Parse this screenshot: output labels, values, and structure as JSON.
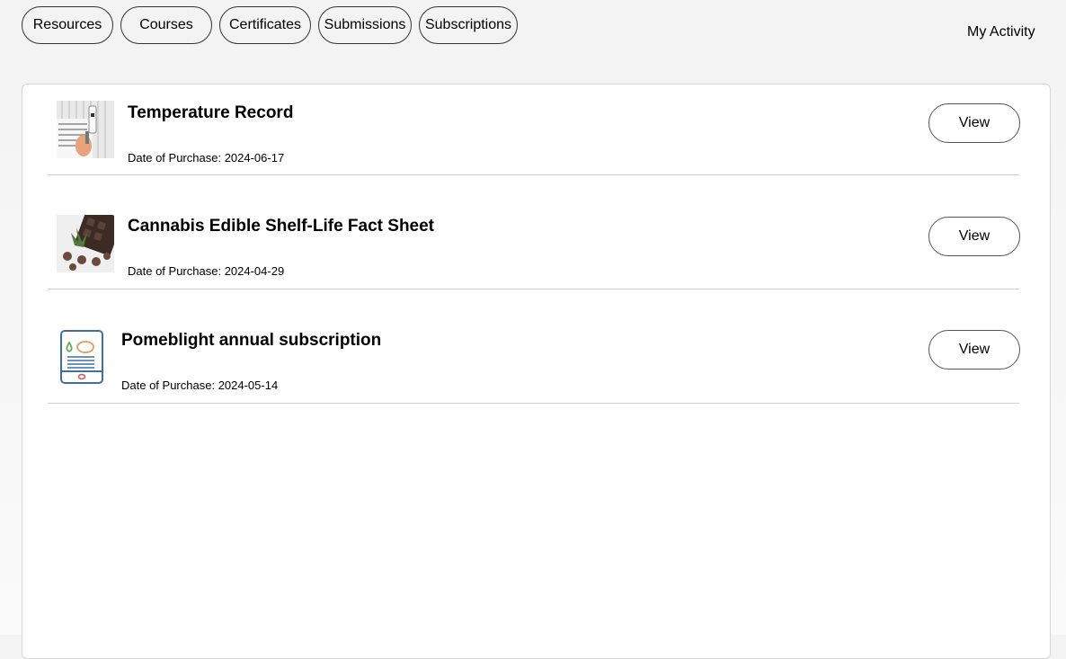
{
  "tabs": [
    {
      "label": "Resources"
    },
    {
      "label": "Courses"
    },
    {
      "label": "Certificates"
    },
    {
      "label": "Submissions"
    },
    {
      "label": "Subscriptions"
    }
  ],
  "header": {
    "my_activity": "My Activity"
  },
  "purchases": [
    {
      "title": "Temperature Record",
      "date_label": "Date of Purchase:",
      "date": "2024-06-17",
      "view_label": "View",
      "thumbnail": "thermometer-photo"
    },
    {
      "title": "Cannabis Edible Shelf-Life Fact Sheet",
      "date_label": "Date of Purchase:",
      "date": "2024-04-29",
      "view_label": "View",
      "thumbnail": "cannabis-chocolate-photo"
    },
    {
      "title": "Pomeblight annual subscription",
      "date_label": "Date of Purchase:",
      "date": "2024-05-14",
      "view_label": "View",
      "thumbnail": "tablet-document-icon"
    }
  ],
  "colors": {
    "page_background": "#f3f3f3",
    "panel_background": "#ffffff",
    "divider": "#cfcfcf",
    "icon_blue": "#3f6fa8",
    "icon_green": "#6aaa5c",
    "icon_orange": "#e59a5c",
    "icon_red": "#d9534f"
  }
}
